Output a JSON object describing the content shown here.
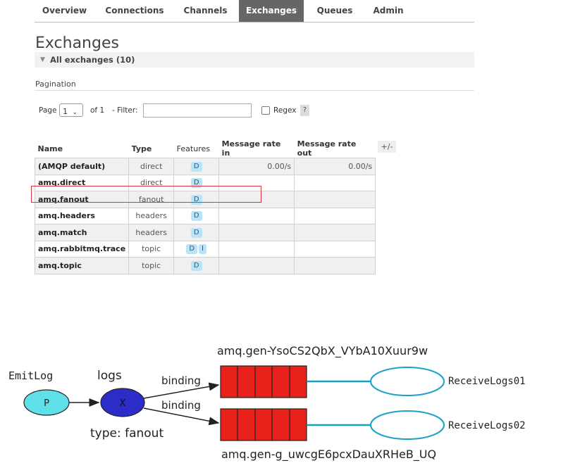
{
  "nav": {
    "tabs": [
      {
        "label": "Overview",
        "active": false
      },
      {
        "label": "Connections",
        "active": false
      },
      {
        "label": "Channels",
        "active": false
      },
      {
        "label": "Exchanges",
        "active": true
      },
      {
        "label": "Queues",
        "active": false
      },
      {
        "label": "Admin",
        "active": false
      }
    ]
  },
  "page": {
    "title": "Exchanges",
    "section_label": "All exchanges (10)"
  },
  "pagination": {
    "heading": "Pagination",
    "page_label": "Page",
    "page_value": "1",
    "of_label": "of 1",
    "filter_label": "- Filter:",
    "filter_value": "",
    "regex_label": "Regex",
    "help_label": "?"
  },
  "table": {
    "headers": [
      "Name",
      "Type",
      "Features",
      "Message rate in",
      "Message rate out"
    ],
    "columns_toggle": "+/-",
    "rows": [
      {
        "name": "(AMQP default)",
        "type": "direct",
        "features": [
          "D"
        ],
        "rate_in": "0.00/s",
        "rate_out": "0.00/s"
      },
      {
        "name": "amq.direct",
        "type": "direct",
        "features": [
          "D"
        ],
        "rate_in": "",
        "rate_out": ""
      },
      {
        "name": "amq.fanout",
        "type": "fanout",
        "features": [
          "D"
        ],
        "rate_in": "",
        "rate_out": ""
      },
      {
        "name": "amq.headers",
        "type": "headers",
        "features": [
          "D"
        ],
        "rate_in": "",
        "rate_out": ""
      },
      {
        "name": "amq.match",
        "type": "headers",
        "features": [
          "D"
        ],
        "rate_in": "",
        "rate_out": ""
      },
      {
        "name": "amq.rabbitmq.trace",
        "type": "topic",
        "features": [
          "D",
          "I"
        ],
        "rate_in": "",
        "rate_out": ""
      },
      {
        "name": "amq.topic",
        "type": "topic",
        "features": [
          "D"
        ],
        "rate_in": "",
        "rate_out": ""
      }
    ]
  },
  "diagram": {
    "producer_name": "EmitLog",
    "producer_label": "P",
    "exchange_name": "logs",
    "exchange_label": "X",
    "exchange_type": "type: fanout",
    "binding_label_1": "binding",
    "binding_label_2": "binding",
    "queue_1": "amq.gen-YsoCS2QbX_VYbA10Xuur9w",
    "queue_2": "amq.gen-g_uwcgE6pcxDauXRHeB_UQ",
    "consumer_1": "ReceiveLogs01",
    "consumer_2": "ReceiveLogs02",
    "colors": {
      "producer": "#5fe0e8",
      "exchange": "#2c2dc9",
      "queue": "#e8211b",
      "consumer_stroke": "#1ba0c8",
      "line": "#1aa0c0"
    }
  }
}
